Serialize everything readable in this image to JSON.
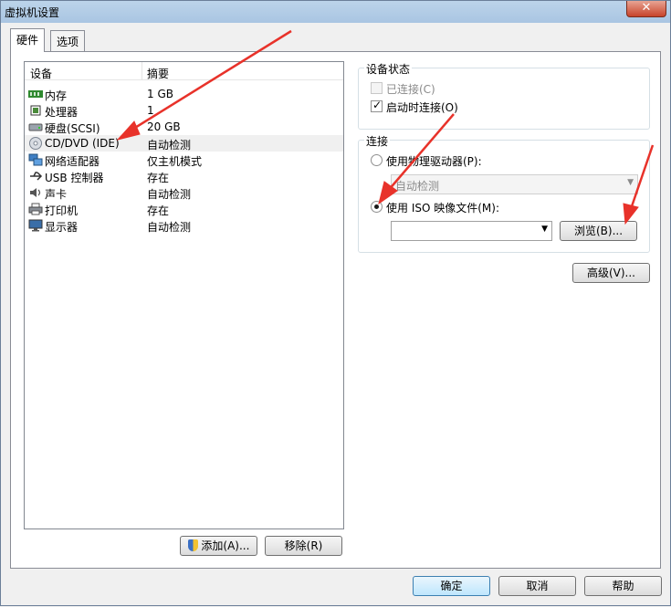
{
  "window": {
    "title": "虚拟机设置",
    "close_label": "✕"
  },
  "tabs": [
    {
      "label": "硬件"
    },
    {
      "label": "选项"
    }
  ],
  "device_list": {
    "columns": [
      "设备",
      "摘要"
    ],
    "rows": [
      {
        "name": "内存",
        "summary": "1 GB",
        "icon": "memory-icon"
      },
      {
        "name": "处理器",
        "summary": "1",
        "icon": "processor-icon"
      },
      {
        "name": "硬盘(SCSI)",
        "summary": "20 GB",
        "icon": "hard-disk-icon"
      },
      {
        "name": "CD/DVD (IDE)",
        "summary": "自动检测",
        "icon": "cd-dvd-icon"
      },
      {
        "name": "网络适配器",
        "summary": "仅主机模式",
        "icon": "network-adapter-icon"
      },
      {
        "name": "USB 控制器",
        "summary": "存在",
        "icon": "usb-icon"
      },
      {
        "name": "声卡",
        "summary": "自动检测",
        "icon": "sound-card-icon"
      },
      {
        "name": "打印机",
        "summary": "存在",
        "icon": "printer-icon"
      },
      {
        "name": "显示器",
        "summary": "自动检测",
        "icon": "display-icon"
      }
    ]
  },
  "list_buttons": {
    "add": "添加(A)...",
    "remove": "移除(R)"
  },
  "device_status": {
    "title": "设备状态",
    "connected": "已连接(C)",
    "connect_at_power_on": "启动时连接(O)"
  },
  "connection": {
    "title": "连接",
    "physical_drive": "使用物理驱动器(P):",
    "physical_value": "自动检测",
    "iso_file": "使用 ISO 映像文件(M):",
    "iso_value": "",
    "browse": "浏览(B)..."
  },
  "advanced_button": "高级(V)...",
  "footer": {
    "ok": "确定",
    "cancel": "取消",
    "help": "帮助"
  },
  "colors": {
    "annotation_arrow": "#e8322a",
    "accent": "#3c7fb1"
  }
}
